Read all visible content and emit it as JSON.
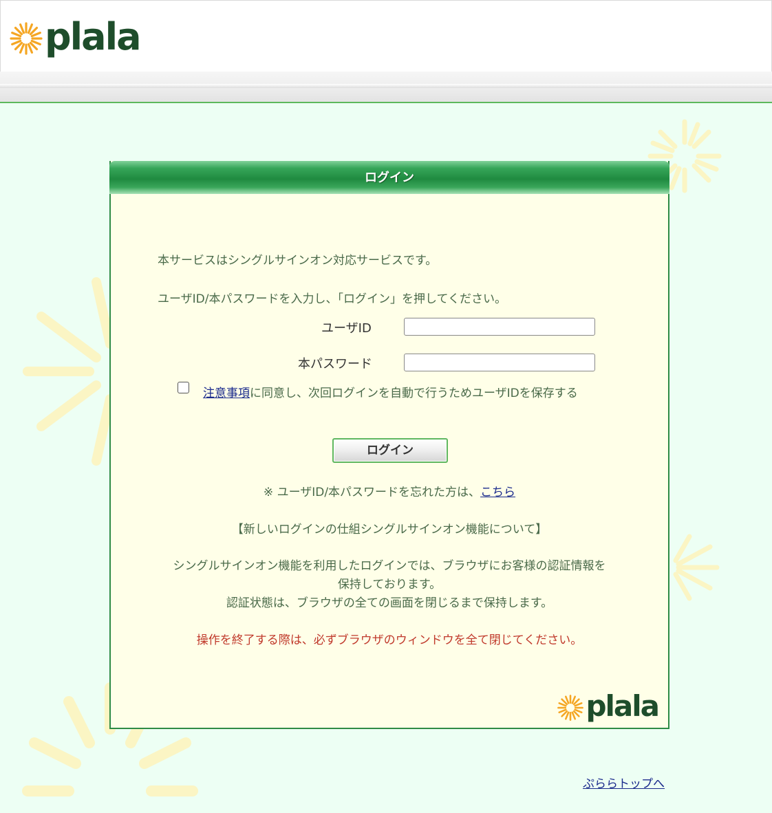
{
  "header": {
    "logo_text": "plala"
  },
  "panel": {
    "title": "ログイン",
    "intro_line1": "本サービスはシングルサインオン対応サービスです。",
    "intro_line2": "ユーザID/本パスワードを入力し、「ログイン」を押してください。",
    "userid_label": "ユーザID",
    "userid_value": "",
    "password_label": "本パスワード",
    "password_value": "",
    "remember_link": "注意事項",
    "remember_text": "に同意し、次回ログインを自動で行うためユーザIDを保存する",
    "login_button": "ログイン",
    "forgot_prefix": "※ ユーザID/本パスワードを忘れた方は、",
    "forgot_link": "こちら",
    "info_title": "【新しいログインの仕組シングルサインオン機能について】",
    "info_line1": "シングルサインオン機能を利用したログインでは、ブラウザにお客様の認証情報を",
    "info_line2": "保持しております。",
    "info_line3": "認証状態は、ブラウザの全ての画面を閉じるまで保持します。",
    "warning": "操作を終了する際は、必ずブラウザのウィンドウを全て閉じてください。",
    "logo_text": "plala"
  },
  "footer": {
    "top_link": "ぷららトップへ"
  },
  "colors": {
    "accent": "#2e8b45",
    "background": "#edfff4",
    "panel_bg": "#ffffe8",
    "logo_sun": "#f5a623"
  }
}
